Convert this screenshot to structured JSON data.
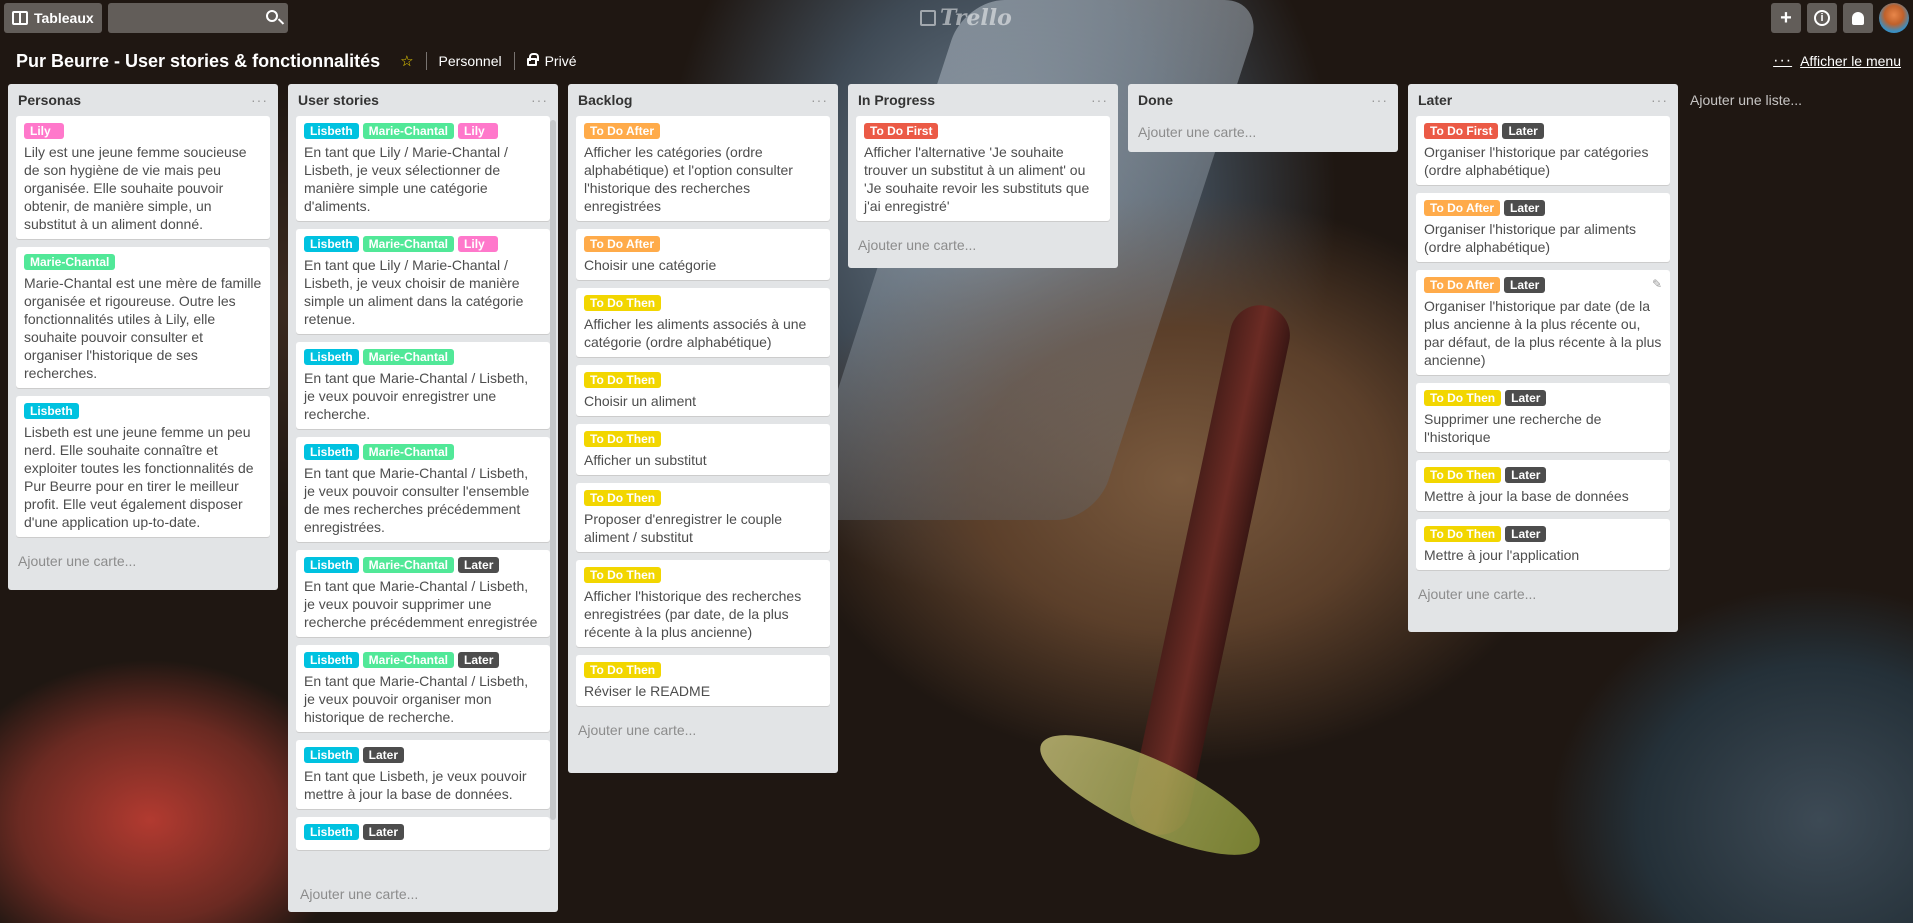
{
  "colors": {
    "pink": "#ff78cb",
    "green": "#51e898",
    "cyan": "#00c2e0",
    "orange": "#ffab4a",
    "yellow": "#f2d600",
    "red": "#eb5a46",
    "dark": "#4d4d4d"
  },
  "topbar": {
    "boards_label": "Tableaux",
    "logo_text": "Trello",
    "icons": [
      "add-icon",
      "info-icon",
      "bell-icon",
      "avatar"
    ]
  },
  "board": {
    "title": "Pur Beurre - User stories & fonctionnalités",
    "team": "Personnel",
    "visibility": "Privé",
    "menu_label": "Afficher le menu",
    "add_list": "Ajouter une liste..."
  },
  "lists": [
    {
      "title": "Personas",
      "add_card": "Ajouter une carte...",
      "cards": [
        {
          "labels": [
            {
              "text": "Lily",
              "color": "#ff78cb"
            }
          ],
          "text": "Lily est une jeune femme soucieuse de son hygiène de vie mais peu organisée. Elle souhaite pouvoir obtenir, de manière simple, un substitut à un aliment donné."
        },
        {
          "labels": [
            {
              "text": "Marie-Chantal",
              "color": "#51e898"
            }
          ],
          "text": "Marie-Chantal est une mère de famille organisée et rigoureuse. Outre les fonctionnalités utiles à Lily, elle souhaite pouvoir consulter et organiser l'historique de ses recherches."
        },
        {
          "labels": [
            {
              "text": "Lisbeth",
              "color": "#00c2e0"
            }
          ],
          "text": "Lisbeth est une jeune femme un peu nerd. Elle souhaite connaître et exploiter toutes les fonctionnalités de Pur Beurre pour en tirer le meilleur profit. Elle veut également disposer d'une application up-to-date."
        }
      ]
    },
    {
      "title": "User stories",
      "add_card": "Ajouter une carte...",
      "cards": [
        {
          "labels": [
            {
              "text": "Lisbeth",
              "color": "#00c2e0"
            },
            {
              "text": "Marie-Chantal",
              "color": "#51e898"
            },
            {
              "text": "Lily",
              "color": "#ff78cb"
            }
          ],
          "text": "En tant que Lily / Marie-Chantal / Lisbeth, je veux sélectionner de manière simple une catégorie d'aliments."
        },
        {
          "labels": [
            {
              "text": "Lisbeth",
              "color": "#00c2e0"
            },
            {
              "text": "Marie-Chantal",
              "color": "#51e898"
            },
            {
              "text": "Lily",
              "color": "#ff78cb"
            }
          ],
          "text": "En tant que Lily / Marie-Chantal / Lisbeth, je veux choisir de manière simple un aliment dans la catégorie retenue."
        },
        {
          "labels": [
            {
              "text": "Lisbeth",
              "color": "#00c2e0"
            },
            {
              "text": "Marie-Chantal",
              "color": "#51e898"
            }
          ],
          "text": "En tant que Marie-Chantal / Lisbeth, je veux pouvoir enregistrer une recherche."
        },
        {
          "labels": [
            {
              "text": "Lisbeth",
              "color": "#00c2e0"
            },
            {
              "text": "Marie-Chantal",
              "color": "#51e898"
            }
          ],
          "text": "En tant que Marie-Chantal / Lisbeth, je veux pouvoir consulter l'ensemble de mes recherches précédemment enregistrées."
        },
        {
          "labels": [
            {
              "text": "Lisbeth",
              "color": "#00c2e0"
            },
            {
              "text": "Marie-Chantal",
              "color": "#51e898"
            },
            {
              "text": "Later",
              "color": "#4d4d4d"
            }
          ],
          "text": "En tant que Marie-Chantal / Lisbeth, je veux pouvoir supprimer une recherche précédemment enregistrée"
        },
        {
          "labels": [
            {
              "text": "Lisbeth",
              "color": "#00c2e0"
            },
            {
              "text": "Marie-Chantal",
              "color": "#51e898"
            },
            {
              "text": "Later",
              "color": "#4d4d4d"
            }
          ],
          "text": "En tant que Marie-Chantal / Lisbeth, je veux pouvoir organiser mon historique de recherche."
        },
        {
          "labels": [
            {
              "text": "Lisbeth",
              "color": "#00c2e0"
            },
            {
              "text": "Later",
              "color": "#4d4d4d"
            }
          ],
          "text": "En tant que Lisbeth, je veux pouvoir mettre à jour la base de données."
        },
        {
          "labels": [
            {
              "text": "Lisbeth",
              "color": "#00c2e0"
            },
            {
              "text": "Later",
              "color": "#4d4d4d"
            }
          ],
          "text": ""
        }
      ]
    },
    {
      "title": "Backlog",
      "add_card": "Ajouter une carte...",
      "cards": [
        {
          "labels": [
            {
              "text": "To Do After",
              "color": "#ffab4a"
            }
          ],
          "text": "Afficher les catégories (ordre alphabétique) et l'option consulter l'historique des recherches enregistrées"
        },
        {
          "labels": [
            {
              "text": "To Do After",
              "color": "#ffab4a"
            }
          ],
          "text": "Choisir une catégorie"
        },
        {
          "labels": [
            {
              "text": "To Do Then",
              "color": "#f2d600"
            }
          ],
          "text": "Afficher les aliments associés à une catégorie (ordre alphabétique)"
        },
        {
          "labels": [
            {
              "text": "To Do Then",
              "color": "#f2d600"
            }
          ],
          "text": "Choisir un aliment"
        },
        {
          "labels": [
            {
              "text": "To Do Then",
              "color": "#f2d600"
            }
          ],
          "text": "Afficher un substitut"
        },
        {
          "labels": [
            {
              "text": "To Do Then",
              "color": "#f2d600"
            }
          ],
          "text": "Proposer d'enregistrer le couple aliment / substitut"
        },
        {
          "labels": [
            {
              "text": "To Do Then",
              "color": "#f2d600"
            }
          ],
          "text": "Afficher l'historique des recherches enregistrées (par date, de la plus récente à la plus ancienne)"
        },
        {
          "labels": [
            {
              "text": "To Do Then",
              "color": "#f2d600"
            }
          ],
          "text": "Réviser le README"
        }
      ]
    },
    {
      "title": "In Progress",
      "add_card": "Ajouter une carte...",
      "cards": [
        {
          "labels": [
            {
              "text": "To Do First",
              "color": "#eb5a46"
            }
          ],
          "text": "Afficher l'alternative 'Je souhaite trouver un substitut à un aliment' ou 'Je souhaite revoir les substituts que j'ai enregistré'"
        }
      ]
    },
    {
      "title": "Done",
      "add_card": "Ajouter une carte...",
      "cards": []
    },
    {
      "title": "Later",
      "add_card": "Ajouter une carte...",
      "cards": [
        {
          "labels": [
            {
              "text": "To Do First",
              "color": "#eb5a46"
            },
            {
              "text": "Later",
              "color": "#4d4d4d"
            }
          ],
          "text": "Organiser l'historique par catégories (ordre alphabétique)"
        },
        {
          "labels": [
            {
              "text": "To Do After",
              "color": "#ffab4a"
            },
            {
              "text": "Later",
              "color": "#4d4d4d"
            }
          ],
          "text": "Organiser l'historique par aliments (ordre alphabétique)"
        },
        {
          "labels": [
            {
              "text": "To Do After",
              "color": "#ffab4a"
            },
            {
              "text": "Later",
              "color": "#4d4d4d"
            }
          ],
          "text": "Organiser l'historique par date (de la plus ancienne à la plus récente ou, par défaut, de la plus récente à la plus ancienne)",
          "edit_icon": "pencil-icon"
        },
        {
          "labels": [
            {
              "text": "To Do Then",
              "color": "#f2d600"
            },
            {
              "text": "Later",
              "color": "#4d4d4d"
            }
          ],
          "text": "Supprimer une recherche de l'historique"
        },
        {
          "labels": [
            {
              "text": "To Do Then",
              "color": "#f2d600"
            },
            {
              "text": "Later",
              "color": "#4d4d4d"
            }
          ],
          "text": "Mettre à jour la base de données"
        },
        {
          "labels": [
            {
              "text": "To Do Then",
              "color": "#f2d600"
            },
            {
              "text": "Later",
              "color": "#4d4d4d"
            }
          ],
          "text": "Mettre à jour l'application"
        }
      ]
    }
  ]
}
